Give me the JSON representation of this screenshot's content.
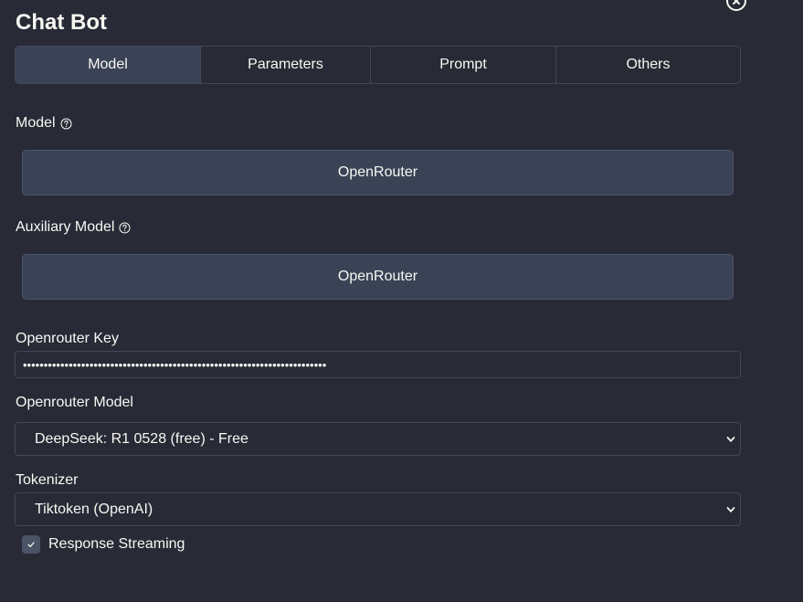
{
  "window": {
    "title": "Chat Bot"
  },
  "tabs": [
    {
      "label": "Model",
      "active": true
    },
    {
      "label": "Parameters",
      "active": false
    },
    {
      "label": "Prompt",
      "active": false
    },
    {
      "label": "Others",
      "active": false
    }
  ],
  "model": {
    "label": "Model",
    "value": "OpenRouter"
  },
  "auxiliary_model": {
    "label": "Auxiliary Model",
    "value": "OpenRouter"
  },
  "openrouter_key": {
    "label": "Openrouter Key",
    "value": "•••••••••••••••••••••••••••••••••••••••••••••••••••••••••••••••••••••••••"
  },
  "openrouter_model": {
    "label": "Openrouter Model",
    "value": "DeepSeek: R1 0528 (free) - Free"
  },
  "tokenizer": {
    "label": "Tokenizer",
    "value": "Tiktoken (OpenAI)"
  },
  "response_streaming": {
    "label": "Response Streaming",
    "checked": true
  },
  "colors": {
    "background": "#282a36",
    "button_bg": "#3a4356",
    "border": "#44475a",
    "text": "#f8f8f2"
  }
}
